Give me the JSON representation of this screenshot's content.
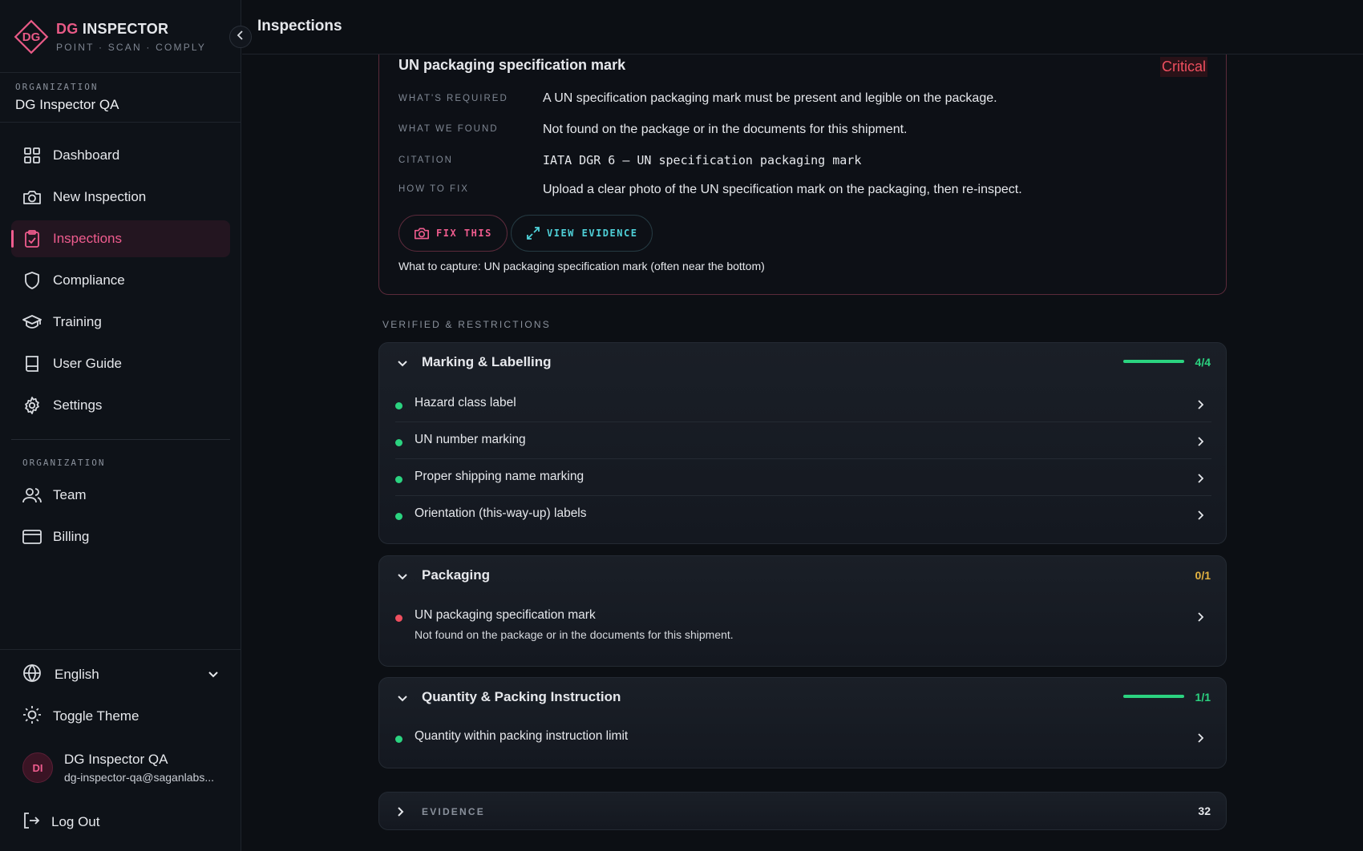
{
  "brand": {
    "logo_text": "DG",
    "name_accent": "DG",
    "name_rest": " INSPECTOR",
    "tagline": "POINT · SCAN · COMPLY"
  },
  "org": {
    "caption": "ORGANIZATION",
    "name": "DG Inspector QA"
  },
  "nav": {
    "items": [
      {
        "label": "Dashboard",
        "icon": "grid-icon"
      },
      {
        "label": "New Inspection",
        "icon": "camera-icon"
      },
      {
        "label": "Inspections",
        "icon": "clipboard-icon",
        "active": true
      },
      {
        "label": "Compliance",
        "icon": "shield-icon"
      },
      {
        "label": "Training",
        "icon": "graduation-cap-icon"
      },
      {
        "label": "User Guide",
        "icon": "book-icon"
      },
      {
        "label": "Settings",
        "icon": "gear-icon"
      }
    ],
    "org_caption": "ORGANIZATION",
    "org_items": [
      {
        "label": "Team",
        "icon": "users-icon"
      },
      {
        "label": "Billing",
        "icon": "credit-card-icon"
      }
    ]
  },
  "footer": {
    "language": "English",
    "toggle_theme": "Toggle Theme",
    "user": {
      "initials": "DI",
      "name": "DG Inspector QA",
      "email": "dg-inspector-qa@saganlabs..."
    },
    "logout": "Log Out"
  },
  "header": {
    "title": "Inspections"
  },
  "issue": {
    "title": "UN packaging specification mark",
    "severity": "Critical",
    "required_label": "WHAT'S REQUIRED",
    "required": "A UN specification packaging mark must be present and legible on the package.",
    "found_label": "WHAT WE FOUND",
    "found": "Not found on the package or in the documents for this shipment.",
    "citation_label": "CITATION",
    "citation": "IATA DGR 6 — UN specification packaging mark",
    "fix_label": "HOW TO FIX",
    "fix": "Upload a clear photo of the UN specification mark on the packaging, then re-inspect.",
    "fix_button": "FIX THIS",
    "evidence_button": "VIEW EVIDENCE",
    "capture_note": "What to capture: UN packaging specification mark (often near the bottom)"
  },
  "verified": {
    "caption": "VERIFIED & RESTRICTIONS",
    "groups": [
      {
        "title": "Marking & Labelling",
        "count": "4/4",
        "progress": 1.0,
        "items": [
          {
            "label": "Hazard class label",
            "status": "pass"
          },
          {
            "label": "UN number marking",
            "status": "pass"
          },
          {
            "label": "Proper shipping name marking",
            "status": "pass"
          },
          {
            "label": "Orientation (this-way-up) labels",
            "status": "pass"
          }
        ]
      },
      {
        "title": "Packaging",
        "count": "0/1",
        "items": [
          {
            "label": "UN packaging specification mark",
            "detail": "Not found on the package or in the documents for this shipment.",
            "status": "fail"
          }
        ]
      },
      {
        "title": "Quantity & Packing Instruction",
        "count": "1/1",
        "progress": 1.0,
        "items": [
          {
            "label": "Quantity within packing instruction limit",
            "status": "pass"
          }
        ]
      }
    ]
  },
  "evidence": {
    "label": "EVIDENCE",
    "count": "32"
  },
  "colors": {
    "accent": "#ef5c8e",
    "pass": "#2bd380",
    "fail": "#ef4f5f",
    "warn": "#e3b341",
    "teal": "#4fd1d9"
  }
}
